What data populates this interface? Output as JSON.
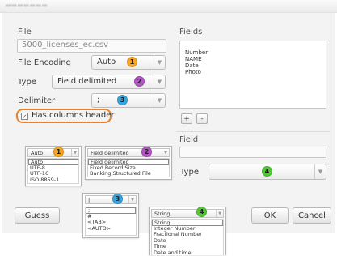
{
  "colors": {
    "badge_1": "#f5a623",
    "badge_2": "#b455c8",
    "badge_3": "#3aa5dc",
    "badge_4": "#55c63a",
    "highlight": "#e8822c"
  },
  "left": {
    "file_section": "File",
    "file_input": "5000_licenses_ec.csv",
    "encoding_label": "File Encoding",
    "encoding_value": "Auto",
    "type_label": "Type",
    "type_value": "Field delimited",
    "delimiter_label": "Delimiter",
    "delimiter_value": ";",
    "has_header_label": "Has columns header",
    "has_header_checked": true
  },
  "right": {
    "fields_section": "Fields",
    "fields": [
      "Number",
      "NAME",
      "Date",
      "Photo"
    ],
    "add_label": "+",
    "remove_label": "-",
    "field_section": "Field",
    "field_name_value": "",
    "field_type_label": "Type"
  },
  "badges": {
    "one": "1",
    "two": "2",
    "three": "3",
    "four": "4"
  },
  "popups": {
    "encoding": {
      "selected": "Auto",
      "options": [
        "Auto",
        "UTF-8",
        "UTF-16",
        "ISO 8859-1"
      ]
    },
    "type": {
      "selected": "Field delimited",
      "options": [
        "Field delimited",
        "Fixed Record Size",
        "Banking Structured File"
      ]
    },
    "delimiter": {
      "selected": "|",
      "options": [
        ";",
        "#",
        "<TAB>",
        "<AUTO>"
      ]
    },
    "datatype": {
      "selected": "String",
      "options": [
        "String",
        "Integer Number",
        "Fractional Number",
        "Date",
        "Time",
        "Date and time"
      ]
    }
  },
  "buttons": {
    "guess": "Guess",
    "ok": "OK",
    "cancel": "Cancel"
  },
  "icons": {
    "dropdown": "chevron-down-icon",
    "checkbox": "check-icon"
  }
}
